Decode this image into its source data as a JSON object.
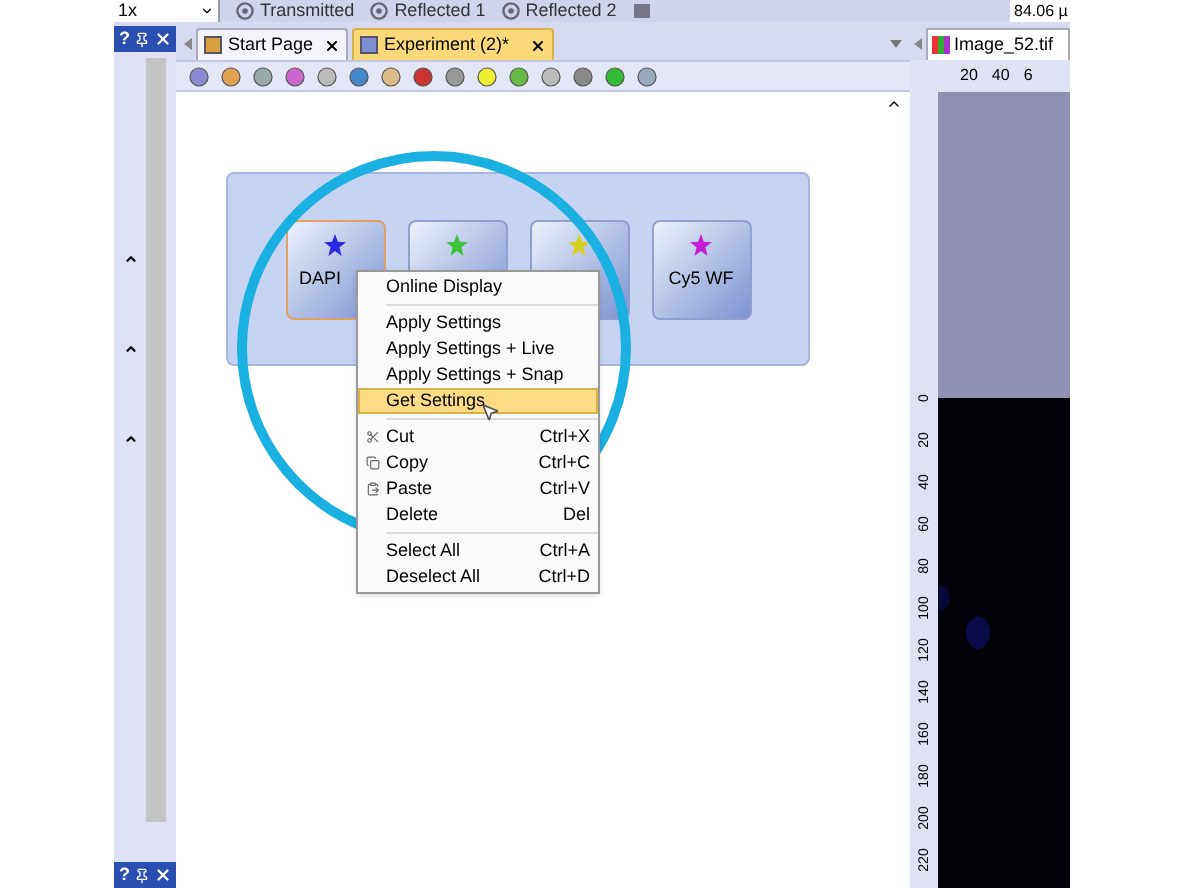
{
  "top_bar": {
    "zoom": "1x",
    "modes": [
      "Transmitted",
      "Reflected 1",
      "Reflected 2"
    ],
    "readout": "84.06 µ"
  },
  "dock_panel": {
    "help": "?"
  },
  "document_tabs": [
    {
      "label": "Start Page",
      "selected": false
    },
    {
      "label": "Experiment (2)*",
      "selected": true
    }
  ],
  "workflow": {
    "nodes": [
      {
        "label": "DAPI",
        "color": "#2a2ae0",
        "selected": true
      },
      {
        "color": "#3cc23c",
        "selected": false
      },
      {
        "color": "#d8d020",
        "selected": false
      },
      {
        "label": "Cy5 WF",
        "color": "#c020d0",
        "selected": false
      }
    ]
  },
  "context_menu": [
    {
      "kind": "item",
      "label": "Online Display",
      "selected": false
    },
    {
      "kind": "separator"
    },
    {
      "kind": "item",
      "label": "Apply Settings",
      "selected": false
    },
    {
      "kind": "item",
      "label": "Apply Settings + Live",
      "selected": false
    },
    {
      "kind": "item",
      "label": "Apply Settings + Snap",
      "selected": false
    },
    {
      "kind": "item",
      "label": "Get Settings",
      "selected": true
    },
    {
      "kind": "separator"
    },
    {
      "kind": "clipboard",
      "label": "Cut",
      "shortcut": "Ctrl+X",
      "selected": false
    },
    {
      "kind": "clipboard",
      "label": "Copy",
      "shortcut": "Ctrl+C",
      "selected": false
    },
    {
      "kind": "clipboard",
      "label": "Paste",
      "shortcut": "Ctrl+V",
      "selected": false
    },
    {
      "kind": "item",
      "label": "Delete",
      "shortcut": "Del",
      "selected": false
    },
    {
      "kind": "separator"
    },
    {
      "kind": "item",
      "label": "Select All",
      "shortcut": "Ctrl+A",
      "selected": false
    },
    {
      "kind": "item",
      "label": "Deselect All",
      "shortcut": "Ctrl+D",
      "selected": false
    }
  ],
  "image_panel": {
    "tab": "Image_52.tif",
    "x_ticks": [
      "20",
      "40",
      "6"
    ],
    "y_ticks": [
      "0",
      "20",
      "40",
      "60",
      "80",
      "100",
      "120",
      "140",
      "160",
      "180",
      "200",
      "220"
    ]
  },
  "bottom_panel": {
    "help": "?"
  }
}
